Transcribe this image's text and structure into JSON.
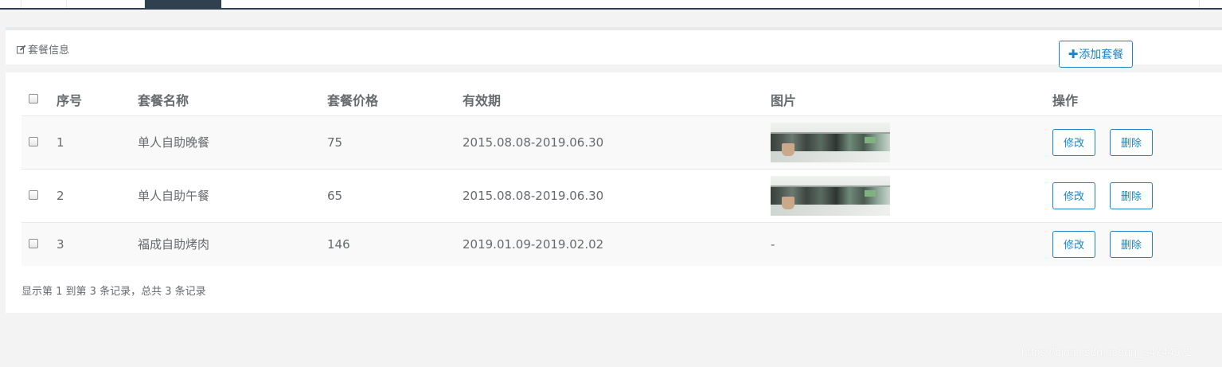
{
  "panel": {
    "title": "套餐信息",
    "add_button": "添加套餐"
  },
  "table": {
    "headers": [
      "序号",
      "套餐名称",
      "套餐价格",
      "有效期",
      "图片",
      "操作"
    ],
    "rows": [
      {
        "id": "1",
        "name": "单人自助晚餐",
        "price": "75",
        "period": "2015.08.08-2019.06.30",
        "image": "thumbnail",
        "edit": "修改",
        "delete": "删除"
      },
      {
        "id": "2",
        "name": "单人自助午餐",
        "price": "65",
        "period": "2015.08.08-2019.06.30",
        "image": "thumbnail",
        "edit": "修改",
        "delete": "删除"
      },
      {
        "id": "3",
        "name": "福成自助烤肉",
        "price": "146",
        "period": "2019.01.09-2019.02.02",
        "image": "-",
        "edit": "修改",
        "delete": "删除"
      }
    ]
  },
  "pagination": {
    "info": "显示第 1 到第 3 条记录，总共 3 条记录"
  },
  "watermark": "https://blog.csdn.net/qq_34744972",
  "colors": {
    "accent": "#1c84c6",
    "nav_active": "#2f4050",
    "text": "#676a6c"
  }
}
